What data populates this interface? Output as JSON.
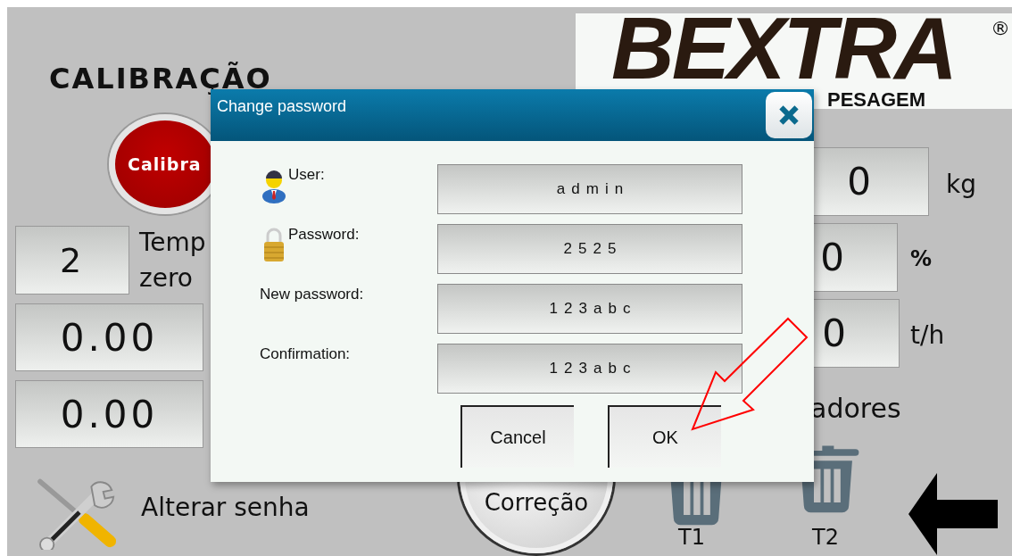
{
  "screen": {
    "logo": {
      "brand": "BEXTRA",
      "registered": "®",
      "tagline": "PESAGEM"
    },
    "title": "CALIBRAÇÃO",
    "calibrate_button": "Calibra",
    "zero_time": {
      "value": "2",
      "label_lines": [
        "Temp",
        "zero"
      ]
    },
    "readings": [
      "0.00",
      "0.00"
    ],
    "right_readings": [
      {
        "value": "0",
        "unit": "kg"
      },
      {
        "value": "0",
        "unit": "%"
      },
      {
        "value": "0",
        "unit": "t/h"
      }
    ],
    "totalizers_label": "adores",
    "correction_button": "Correção",
    "trash_buttons": [
      {
        "label": "T1"
      },
      {
        "label": "T2"
      }
    ],
    "change_password": "Alterar senha"
  },
  "dialog": {
    "title": "Change password",
    "fields": [
      {
        "kind": "user",
        "label": "User:",
        "value": "admin"
      },
      {
        "kind": "lock",
        "label": "Password:",
        "value": "2525"
      },
      {
        "kind": "plain",
        "label": "New password:",
        "value": "123abc"
      },
      {
        "kind": "plain",
        "label": "Confirmation:",
        "value": "123abc"
      }
    ],
    "buttons": [
      "Cancel",
      "OK"
    ]
  }
}
